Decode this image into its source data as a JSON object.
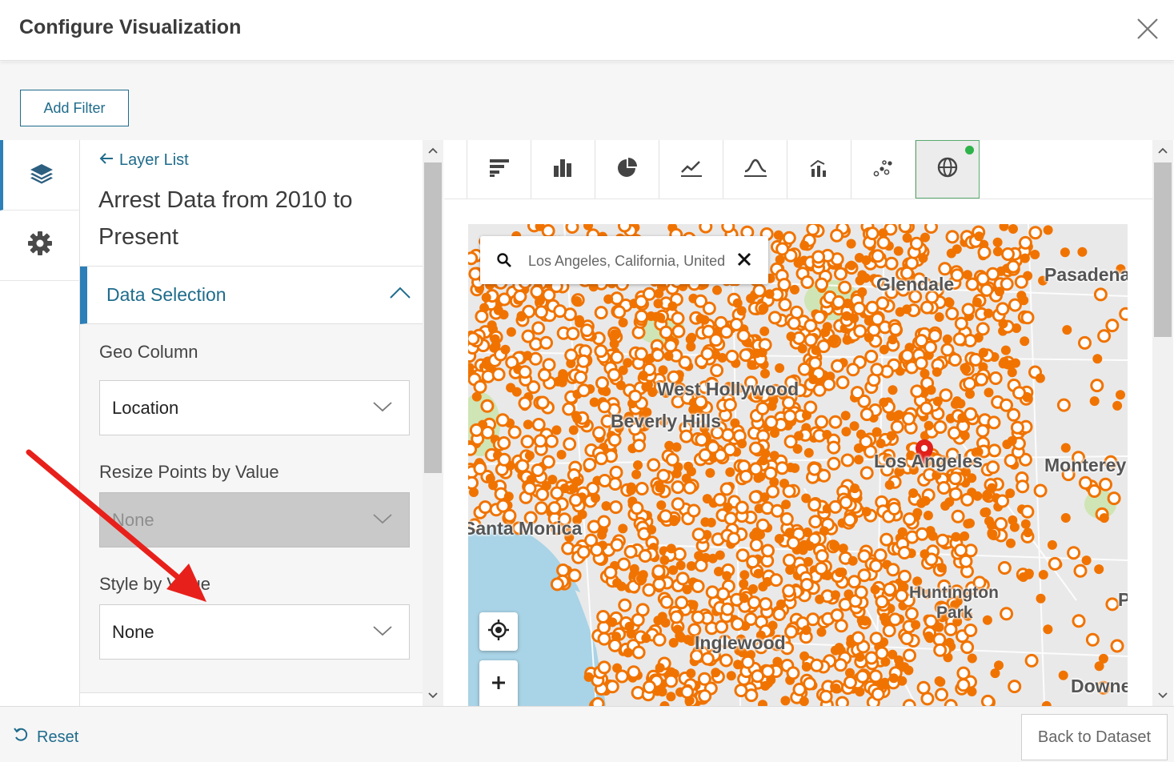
{
  "header": {
    "title": "Configure Visualization",
    "close_icon": "close-icon"
  },
  "toolbar": {
    "add_filter_label": "Add Filter"
  },
  "side_rail": {
    "items": [
      {
        "icon": "layers-icon",
        "active": true
      },
      {
        "icon": "gear-icon",
        "active": false
      }
    ]
  },
  "panel": {
    "back_label": "Layer List",
    "layer_title": "Arrest Data from 2010 to Present",
    "section_label": "Data Selection",
    "geo_column": {
      "label": "Geo Column",
      "value": "Location"
    },
    "resize_points": {
      "label": "Resize Points by Value",
      "value": "None",
      "disabled": true
    },
    "style_by_value": {
      "label": "Style by Value",
      "value": "None"
    }
  },
  "chart_tabs": [
    {
      "icon": "bar-horizontal-icon",
      "active": false
    },
    {
      "icon": "bar-vertical-icon",
      "active": false
    },
    {
      "icon": "pie-chart-icon",
      "active": false
    },
    {
      "icon": "line-chart-icon",
      "active": false
    },
    {
      "icon": "area-chart-icon",
      "active": false
    },
    {
      "icon": "combo-chart-icon",
      "active": false
    },
    {
      "icon": "scatter-plot-icon",
      "active": false
    },
    {
      "icon": "globe-map-icon",
      "active": true
    }
  ],
  "map": {
    "search_value": "Los Angeles, California, United",
    "labels": [
      "Glendale",
      "Pasadena",
      "West Hollywood",
      "Beverly Hills",
      "Los Angeles",
      "Monterey",
      "Santa Monica",
      "Huntington",
      "Park",
      "Inglewood",
      "Downey",
      "P"
    ],
    "point_color": "#f07300",
    "marker_color": "#e0201b",
    "locate_icon": "locate-icon",
    "zoom_in_icon": "plus-icon"
  },
  "footer": {
    "reset_label": "Reset",
    "back_label": "Back to Dataset"
  },
  "colors": {
    "accent": "#1f6c8c",
    "rail_active": "#2c7fb8",
    "active_dot": "#2eb34a",
    "annotation_arrow": "#e8201b"
  }
}
